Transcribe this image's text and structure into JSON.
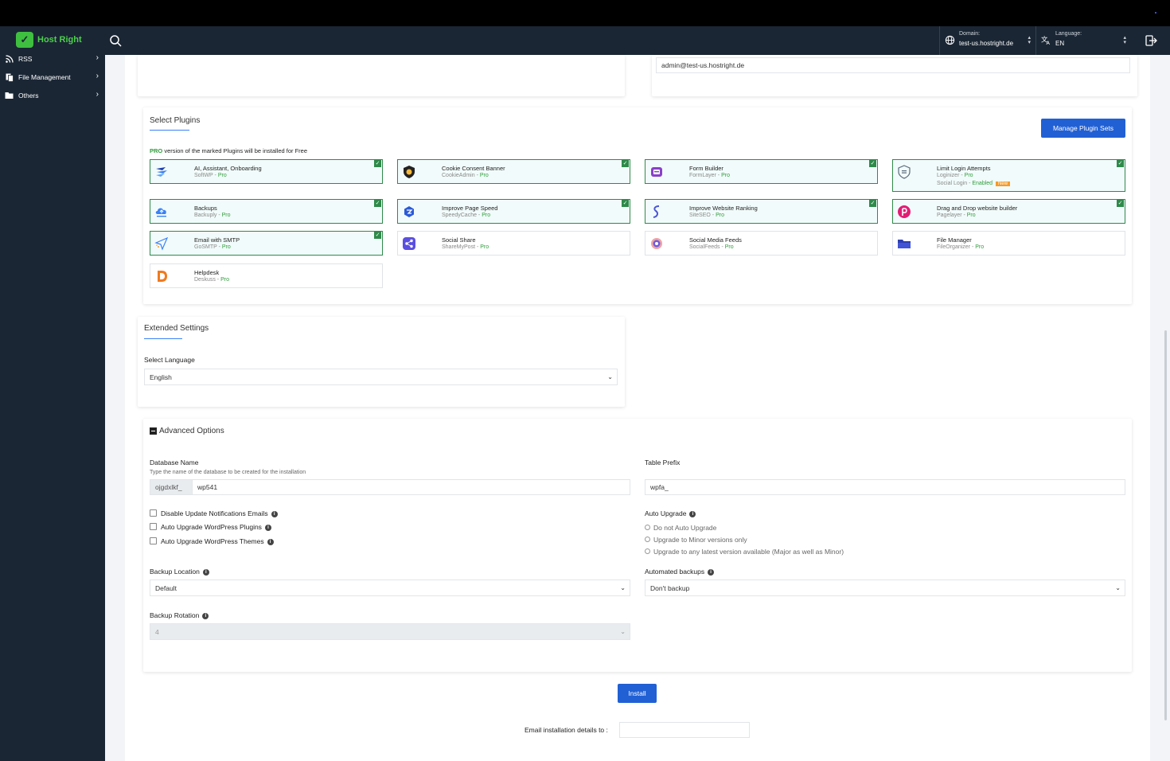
{
  "navbar": {
    "brand": "Host Right",
    "domain_label": "Domain:",
    "domain_value": "test-us.hostright.de",
    "language_label": "Language:",
    "language_value": "EN"
  },
  "sidebar": {
    "items": [
      {
        "label": "RSS"
      },
      {
        "label": "File Management"
      },
      {
        "label": "Others"
      }
    ]
  },
  "top_partial": {
    "admin_email": "admin@test-us.hostright.de"
  },
  "plugins": {
    "title": "Select Plugins",
    "manage_button": "Manage Plugin Sets",
    "pro_word": "PRO",
    "pro_note": "version of the marked Plugins will be installed for Free",
    "items": [
      {
        "name": "AI, Assistant, Onboarding",
        "vendor": "SoftWP",
        "tier": "Pro",
        "selected": true,
        "icon": "softwp-icon"
      },
      {
        "name": "Cookie Consent Banner",
        "vendor": "CookieAdmin",
        "tier": "Pro",
        "selected": true,
        "icon": "cookie-shield-icon"
      },
      {
        "name": "Form Builder",
        "vendor": "FormLayer",
        "tier": "Pro",
        "selected": true,
        "icon": "form-builder-icon"
      },
      {
        "name": "Limit Login Attempts",
        "vendor": "Loginizer",
        "tier": "Pro",
        "selected": true,
        "icon": "login-shield-icon",
        "extra": "Social Login",
        "extra_status": "Enabled",
        "extra_badge": "New"
      },
      {
        "name": "Backups",
        "vendor": "Backuply",
        "tier": "Pro",
        "selected": true,
        "icon": "cloud-backup-icon"
      },
      {
        "name": "Improve Page Speed",
        "vendor": "SpeedyCache",
        "tier": "Pro",
        "selected": true,
        "icon": "speed-icon"
      },
      {
        "name": "Improve Website Ranking",
        "vendor": "SiteSEO",
        "tier": "Pro",
        "selected": true,
        "icon": "seo-icon"
      },
      {
        "name": "Drag and Drop website builder",
        "vendor": "Pagelayer",
        "tier": "Pro",
        "selected": true,
        "icon": "pagelayer-icon"
      },
      {
        "name": "Email with SMTP",
        "vendor": "GoSMTP",
        "tier": "Pro",
        "selected": true,
        "icon": "smtp-icon"
      },
      {
        "name": "Social Share",
        "vendor": "ShareMyPost",
        "tier": "Pro",
        "selected": false,
        "icon": "share-icon"
      },
      {
        "name": "Social Media Feeds",
        "vendor": "SocialFeeds",
        "tier": "Pro",
        "selected": false,
        "icon": "feeds-icon"
      },
      {
        "name": "File Manager",
        "vendor": "FileOrganizer",
        "tier": "Pro",
        "selected": false,
        "icon": "folder-icon"
      },
      {
        "name": "Helpdesk",
        "vendor": "Deskuss",
        "tier": "Pro",
        "selected": false,
        "icon": "helpdesk-icon"
      }
    ]
  },
  "extended": {
    "title": "Extended Settings",
    "language_label": "Select Language",
    "language_value": "English"
  },
  "advanced": {
    "title": "Advanced Options",
    "db_label": "Database Name",
    "db_help": "Type the name of the database to be created for the installation",
    "db_prefix": "ojgdxlkf_",
    "db_value": "wp541",
    "table_prefix_label": "Table Prefix",
    "table_prefix_value": "wpfa_",
    "checkboxes": [
      {
        "label": "Disable Update Notifications Emails"
      },
      {
        "label": "Auto Upgrade WordPress Plugins"
      },
      {
        "label": "Auto Upgrade WordPress Themes"
      }
    ],
    "auto_upgrade_label": "Auto Upgrade",
    "auto_upgrade_options": [
      {
        "label": "Do not Auto Upgrade"
      },
      {
        "label": "Upgrade to Minor versions only"
      },
      {
        "label": "Upgrade to any latest version available (Major as well as Minor)"
      }
    ],
    "backup_location_label": "Backup Location",
    "backup_location_value": "Default",
    "automated_backups_label": "Automated backups",
    "automated_backups_value": "Don't backup",
    "backup_rotation_label": "Backup Rotation",
    "backup_rotation_value": "4"
  },
  "install_button": "Install",
  "email_details_label": "Email installation details to :",
  "colors": {
    "primary": "#2160d4",
    "pro_green": "#2e9d3a",
    "nav_bg": "#1a2634"
  }
}
